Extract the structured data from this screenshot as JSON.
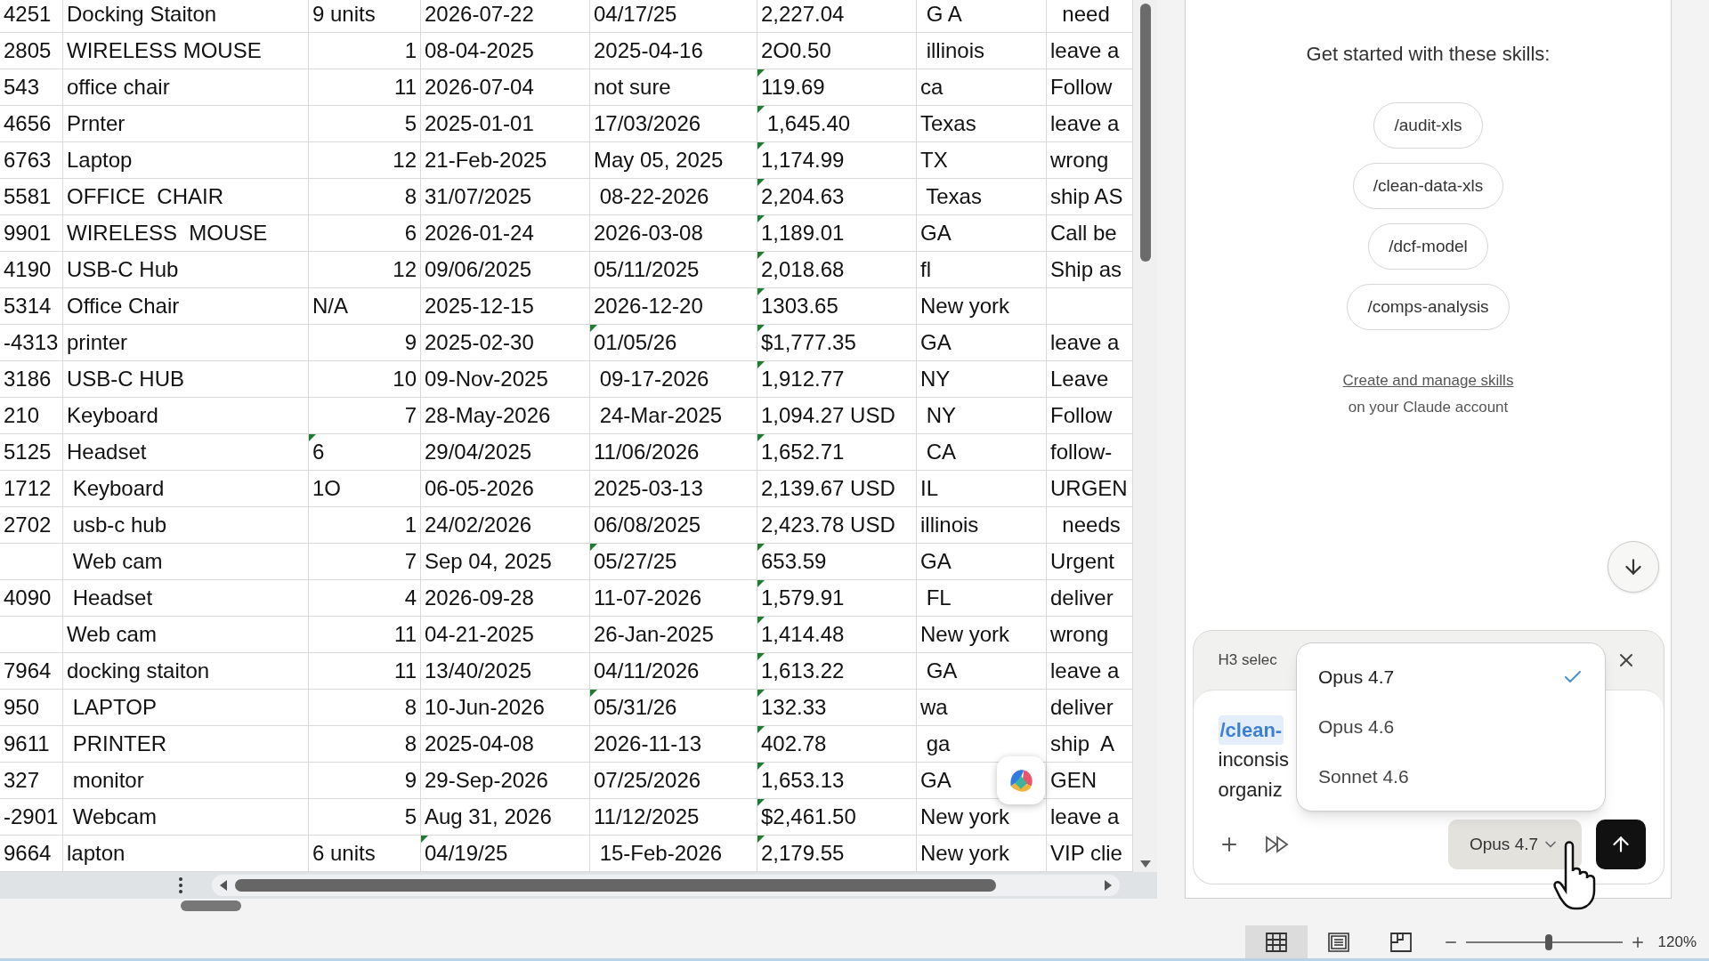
{
  "sheet": {
    "rows": [
      {
        "cells": [
          "4251",
          "Docking Staiton",
          "9 units",
          "2026-07-22",
          "04/17/25",
          "2,227.04",
          " G A",
          "  need"
        ],
        "qty_numeric": false,
        "flags": [
          false,
          false,
          false,
          false,
          false,
          false,
          false,
          false
        ]
      },
      {
        "cells": [
          "2805",
          "WIRELESS MOUSE",
          "1",
          "08-04-2025",
          "2025-04-16",
          "2O0.50",
          " illinois",
          "leave a"
        ],
        "qty_numeric": true,
        "flags": [
          false,
          false,
          false,
          false,
          false,
          false,
          false,
          false
        ]
      },
      {
        "cells": [
          "543",
          "office chair",
          "11",
          "2026-07-04",
          "not sure",
          "119.69",
          "ca",
          "Follow"
        ],
        "qty_numeric": true,
        "flags": [
          false,
          false,
          false,
          false,
          false,
          true,
          false,
          false
        ]
      },
      {
        "cells": [
          "4656",
          "Prnter",
          "5",
          "2025-01-01",
          "17/03/2026",
          " 1,645.40",
          "Texas",
          "leave a"
        ],
        "qty_numeric": true,
        "flags": [
          false,
          false,
          false,
          false,
          false,
          true,
          false,
          false
        ]
      },
      {
        "cells": [
          "6763",
          "Laptop",
          "12",
          "21-Feb-2025",
          "May 05, 2025",
          "1,174.99",
          "TX",
          "wrong"
        ],
        "qty_numeric": true,
        "flags": [
          false,
          false,
          false,
          false,
          false,
          true,
          false,
          false
        ]
      },
      {
        "cells": [
          "5581",
          "OFFICE  CHAIR",
          "8",
          "31/07/2025",
          " 08-22-2026",
          "2,204.63",
          " Texas",
          "ship AS"
        ],
        "qty_numeric": true,
        "flags": [
          false,
          false,
          false,
          false,
          false,
          true,
          false,
          false
        ]
      },
      {
        "cells": [
          "9901",
          "WIRELESS  MOUSE",
          "6",
          "2026-01-24",
          "2026-03-08",
          "1,189.01",
          "GA",
          "Call be"
        ],
        "qty_numeric": true,
        "flags": [
          false,
          false,
          false,
          false,
          false,
          true,
          false,
          false
        ]
      },
      {
        "cells": [
          "4190",
          "USB-C Hub",
          "12",
          "09/06/2025",
          "05/11/2025",
          "2,018.68",
          "fl",
          "Ship as"
        ],
        "qty_numeric": true,
        "flags": [
          false,
          false,
          false,
          false,
          false,
          true,
          false,
          false
        ]
      },
      {
        "cells": [
          "5314",
          "Office Chair",
          "N/A",
          "2025-12-15",
          "2026-12-20",
          "1303.65",
          "New york",
          null
        ],
        "qty_numeric": false,
        "flags": [
          false,
          false,
          false,
          false,
          false,
          true,
          false,
          false
        ]
      },
      {
        "cells": [
          "-4313",
          "printer",
          "9",
          "2025-02-30",
          "01/05/26",
          "$1,777.35",
          "GA",
          "leave a"
        ],
        "qty_numeric": true,
        "flags": [
          false,
          false,
          false,
          false,
          true,
          true,
          false,
          false
        ]
      },
      {
        "cells": [
          "3186",
          "USB-C HUB",
          "10",
          "09-Nov-2025",
          " 09-17-2026",
          "1,912.77",
          "NY",
          "Leave"
        ],
        "qty_numeric": true,
        "flags": [
          false,
          false,
          false,
          false,
          false,
          true,
          false,
          false
        ]
      },
      {
        "cells": [
          "210",
          "Keyboard",
          "7",
          "28-May-2026",
          " 24-Mar-2025",
          "1,094.27 USD",
          " NY",
          "Follow"
        ],
        "qty_numeric": true,
        "flags": [
          false,
          false,
          false,
          false,
          false,
          false,
          false,
          false
        ]
      },
      {
        "cells": [
          "5125",
          "Headset",
          "6",
          "29/04/2025",
          "11/06/2026",
          "1,652.71",
          " CA",
          "follow-"
        ],
        "qty_numeric": false,
        "flags": [
          false,
          false,
          true,
          false,
          false,
          true,
          false,
          false
        ]
      },
      {
        "cells": [
          "1712",
          " Keyboard",
          "1O",
          "06-05-2026",
          "2025-03-13",
          "2,139.67 USD",
          "IL",
          "URGEN"
        ],
        "qty_numeric": false,
        "flags": [
          false,
          false,
          false,
          false,
          false,
          false,
          false,
          false
        ]
      },
      {
        "cells": [
          "2702",
          " usb-c hub",
          "1",
          "24/02/2026",
          "06/08/2025",
          "2,423.78 USD",
          "illinois",
          "  needs"
        ],
        "qty_numeric": true,
        "flags": [
          false,
          false,
          false,
          false,
          false,
          false,
          false,
          false
        ]
      },
      {
        "cells": [
          null,
          " Web cam",
          "7",
          "Sep 04, 2025",
          "05/27/25",
          "653.59",
          "GA",
          "Urgent"
        ],
        "qty_numeric": true,
        "flags": [
          false,
          false,
          false,
          false,
          true,
          true,
          false,
          false
        ]
      },
      {
        "cells": [
          "4090",
          " Headset",
          "4",
          "2026-09-28",
          "11-07-2026",
          "1,579.91",
          " FL",
          "deliver"
        ],
        "qty_numeric": true,
        "flags": [
          false,
          false,
          false,
          false,
          false,
          true,
          false,
          false
        ]
      },
      {
        "cells": [
          null,
          "Web cam",
          "11",
          "04-21-2025",
          "26-Jan-2025",
          "1,414.48",
          "New york",
          "wrong"
        ],
        "qty_numeric": true,
        "flags": [
          false,
          false,
          false,
          false,
          false,
          true,
          false,
          false
        ]
      },
      {
        "cells": [
          "7964",
          "docking staiton",
          "11",
          "13/40/2025",
          "04/11/2026",
          "1,613.22",
          " GA",
          "leave a"
        ],
        "qty_numeric": true,
        "flags": [
          false,
          false,
          false,
          false,
          false,
          true,
          false,
          false
        ]
      },
      {
        "cells": [
          "950",
          " LAPTOP",
          "8",
          "10-Jun-2026",
          "05/31/26",
          "132.33",
          "wa",
          "deliver"
        ],
        "qty_numeric": true,
        "flags": [
          false,
          false,
          false,
          false,
          true,
          true,
          false,
          false
        ]
      },
      {
        "cells": [
          "9611",
          " PRINTER",
          "8",
          "2025-04-08",
          "2026-11-13",
          "402.78",
          " ga",
          "ship  A"
        ],
        "qty_numeric": true,
        "flags": [
          false,
          false,
          false,
          false,
          false,
          true,
          false,
          false
        ]
      },
      {
        "cells": [
          "327",
          " monitor",
          "9",
          "29-Sep-2026",
          "07/25/2026",
          "1,653.13",
          "GA",
          "GEN"
        ],
        "qty_numeric": true,
        "flags": [
          false,
          false,
          false,
          false,
          false,
          true,
          false,
          false
        ]
      },
      {
        "cells": [
          "-2901",
          " Webcam",
          "5",
          "Aug 31, 2026",
          "11/12/2025",
          "$2,461.50",
          "New york",
          "leave a"
        ],
        "qty_numeric": true,
        "flags": [
          false,
          false,
          false,
          false,
          false,
          true,
          false,
          false
        ]
      },
      {
        "cells": [
          "9664",
          "lapton",
          "6 units",
          "04/19/25",
          " 15-Feb-2026",
          "2,179.55",
          "New york",
          "VIP clie"
        ],
        "qty_numeric": false,
        "flags": [
          false,
          false,
          false,
          true,
          false,
          true,
          false,
          false
        ]
      }
    ]
  },
  "assistant": {
    "heading": "Get started with these skills:",
    "skills": [
      "/audit-xls",
      "/clean-data-xls",
      "/dcf-model",
      "/comps-analysis"
    ],
    "manage_link": "Create and manage skills",
    "manage_note": "on your Claude account",
    "composer": {
      "context": "H3 selec",
      "command": "/clean-",
      "lines": [
        "inconsis",
        "organiz"
      ],
      "model": "Opus 4.7"
    },
    "model_menu": [
      {
        "label": "Opus 4.7",
        "selected": true
      },
      {
        "label": "Opus 4.6",
        "selected": false
      },
      {
        "label": "Sonnet 4.6",
        "selected": false
      }
    ]
  },
  "status_bar": {
    "views": [
      {
        "kind": "normal",
        "selected": true
      },
      {
        "kind": "page_layout",
        "selected": false
      },
      {
        "kind": "page_break",
        "selected": false
      }
    ],
    "zoom": {
      "level": 0.53,
      "reading": "120%"
    }
  }
}
